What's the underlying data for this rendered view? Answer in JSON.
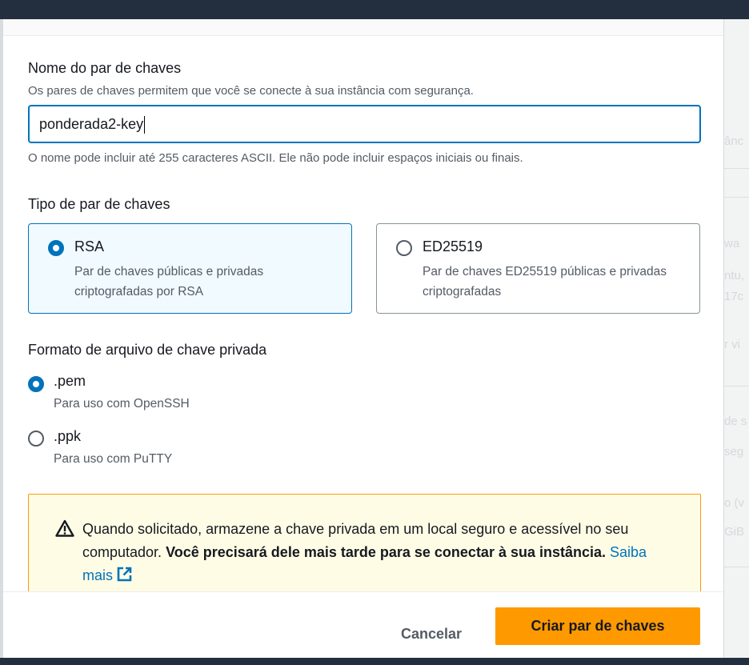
{
  "key_name": {
    "label": "Nome do par de chaves",
    "description": "Os pares de chaves permitem que você se conecte à sua instância com segurança.",
    "value": "ponderada2-key",
    "constraint": "O nome pode incluir até 255 caracteres ASCII. Ele não pode incluir espaços iniciais ou finais."
  },
  "key_type": {
    "label": "Tipo de par de chaves",
    "options": [
      {
        "name": "RSA",
        "description": "Par de chaves públicas e privadas criptografadas por RSA",
        "selected": true
      },
      {
        "name": "ED25519",
        "description": "Par de chaves ED25519 públicas e privadas criptografadas",
        "selected": false
      }
    ]
  },
  "file_format": {
    "label": "Formato de arquivo de chave privada",
    "options": [
      {
        "name": ".pem",
        "description": "Para uso com OpenSSH",
        "selected": true
      },
      {
        "name": ".ppk",
        "description": "Para uso com PuTTY",
        "selected": false
      }
    ]
  },
  "alert": {
    "icon": "warning-icon",
    "text_plain": "Quando solicitado, armazene a chave privada em um local seguro e acessível no seu computador. ",
    "text_bold": "Você precisará dele mais tarde para se conectar à sua instância.",
    "link_text": "Saiba mais",
    "link_icon": "external-link-icon"
  },
  "footer": {
    "cancel_label": "Cancelar",
    "create_label": "Criar par de chaves"
  },
  "background_page": {
    "fragments": [
      "ânc",
      "wa",
      "ntu,",
      "17c",
      "r vi",
      "de s",
      "seg",
      "o (v",
      "GiB"
    ]
  },
  "colors": {
    "accent": "#0073bb",
    "primary_button": "#ff9900",
    "alert_bg": "#fffce6",
    "header": "#232f3e"
  }
}
